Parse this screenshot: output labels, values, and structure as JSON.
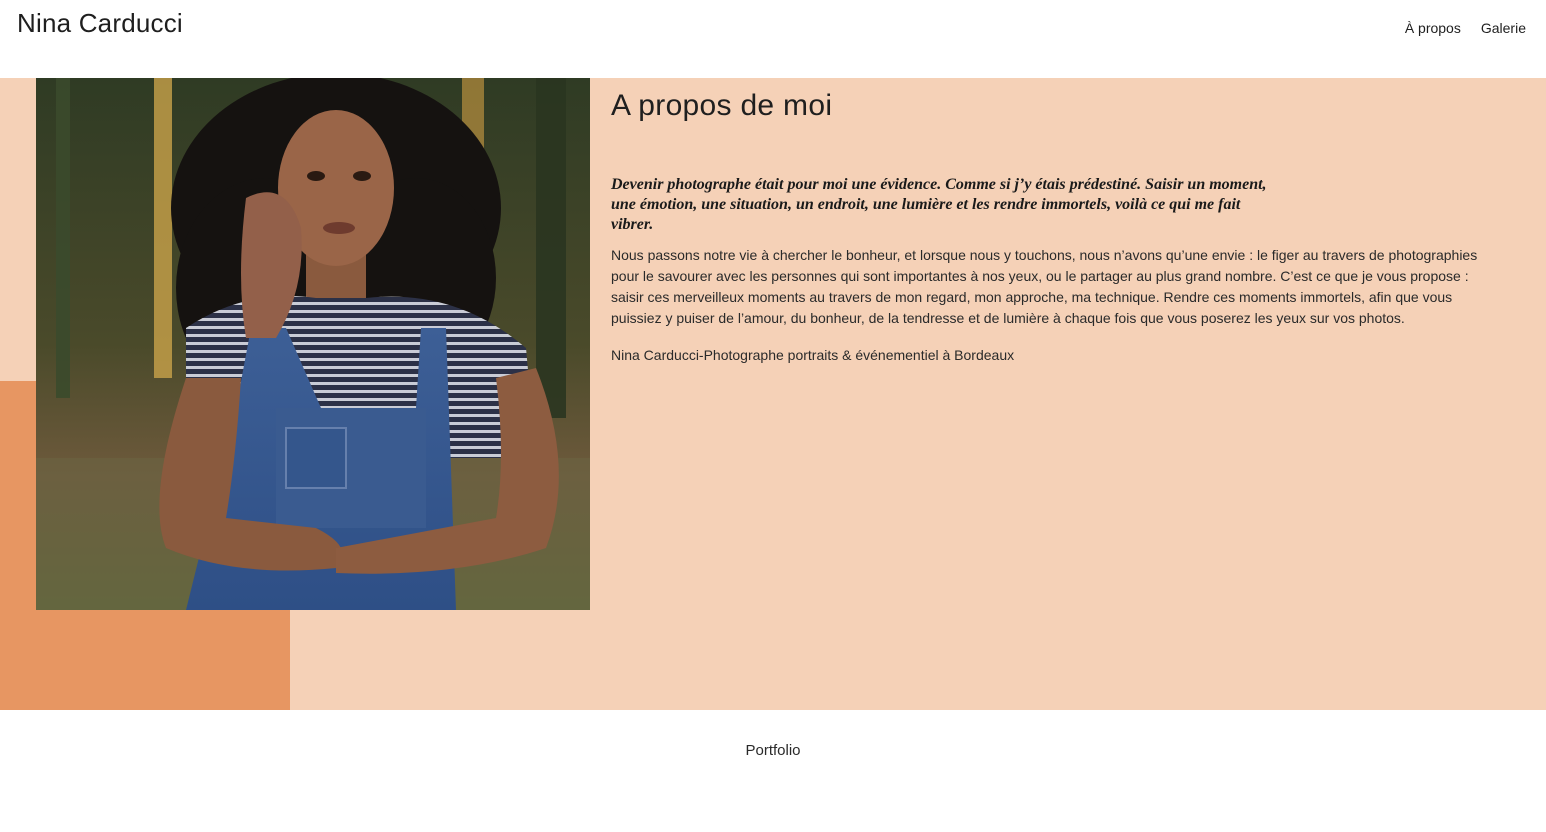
{
  "header": {
    "brand": "Nina Carducci",
    "nav": [
      {
        "label": "À propos"
      },
      {
        "label": "Galerie"
      }
    ]
  },
  "about": {
    "title": "A propos de moi",
    "quote": "Devenir photographe était pour moi une évidence. Comme si j’y étais prédestiné. Saisir un moment, une émotion, une situation, un endroit, une lumière et les rendre immortels, voilà ce qui me fait vibrer.",
    "body": "Nous passons notre vie à chercher le bonheur, et lorsque nous y touchons, nous n’avons qu’une envie : le figer au travers de photographies pour le savourer avec les personnes qui sont importantes à nos yeux, ou le partager au plus grand nombre. C’est ce que je vous propose : saisir ces merveilleux moments au travers de mon regard, mon approche, ma technique. Rendre ces moments immortels, afin que vous puissiez y puiser de l’amour, du bonheur, de la tendresse et de lumière à chaque fois que vous poserez les yeux sur vos photos.",
    "signature": "Nina Carducci-Photographe portraits & événementiel à Bordeaux"
  },
  "footer": {
    "label": "Portfolio"
  },
  "colors": {
    "about_bg": "#f5d1b7",
    "accent": "#e79662"
  }
}
